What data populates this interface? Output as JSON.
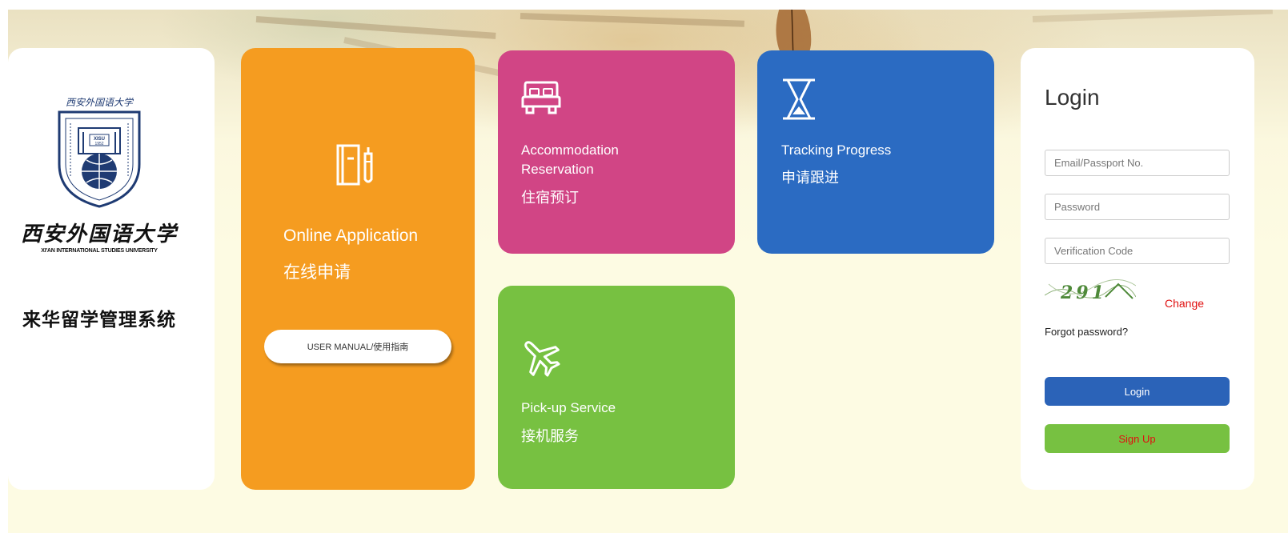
{
  "university": {
    "crest_text": "西安外国语大学",
    "crest_abbr": "XISU",
    "crest_year": "1952",
    "crest_ring_text": "XI'AN INTERNATIONAL STUDIES UNIVERSITY",
    "name_cn": "西安外国语大学",
    "name_en": "XI'AN INTERNATIONAL STUDIES UNIVERSITY",
    "system_name": "来华留学管理系统"
  },
  "tiles": {
    "online_application": {
      "title": "Online Application",
      "subtitle": "在线申请",
      "icon": "notebook-pen-icon",
      "color": "#f59c20",
      "manual_button": "USER MANUAL/使用指南"
    },
    "accommodation": {
      "title": "Accommodation Reservation",
      "subtitle": "住宿预订",
      "icon": "bed-icon",
      "color": "#d14585"
    },
    "tracking": {
      "title": "Tracking Progress",
      "subtitle": "申请跟进",
      "icon": "hourglass-icon",
      "color": "#2b6bc2"
    },
    "pickup": {
      "title": "Pick-up Service",
      "subtitle": "接机服务",
      "icon": "airplane-icon",
      "color": "#77c141"
    }
  },
  "login": {
    "title": "Login",
    "email_placeholder": "Email/Passport No.",
    "password_placeholder": "Password",
    "code_placeholder": "Verification Code",
    "captcha_text": "291",
    "change_label": "Change",
    "forgot_label": "Forgot password?",
    "login_button": "Login",
    "signup_button": "Sign Up"
  }
}
